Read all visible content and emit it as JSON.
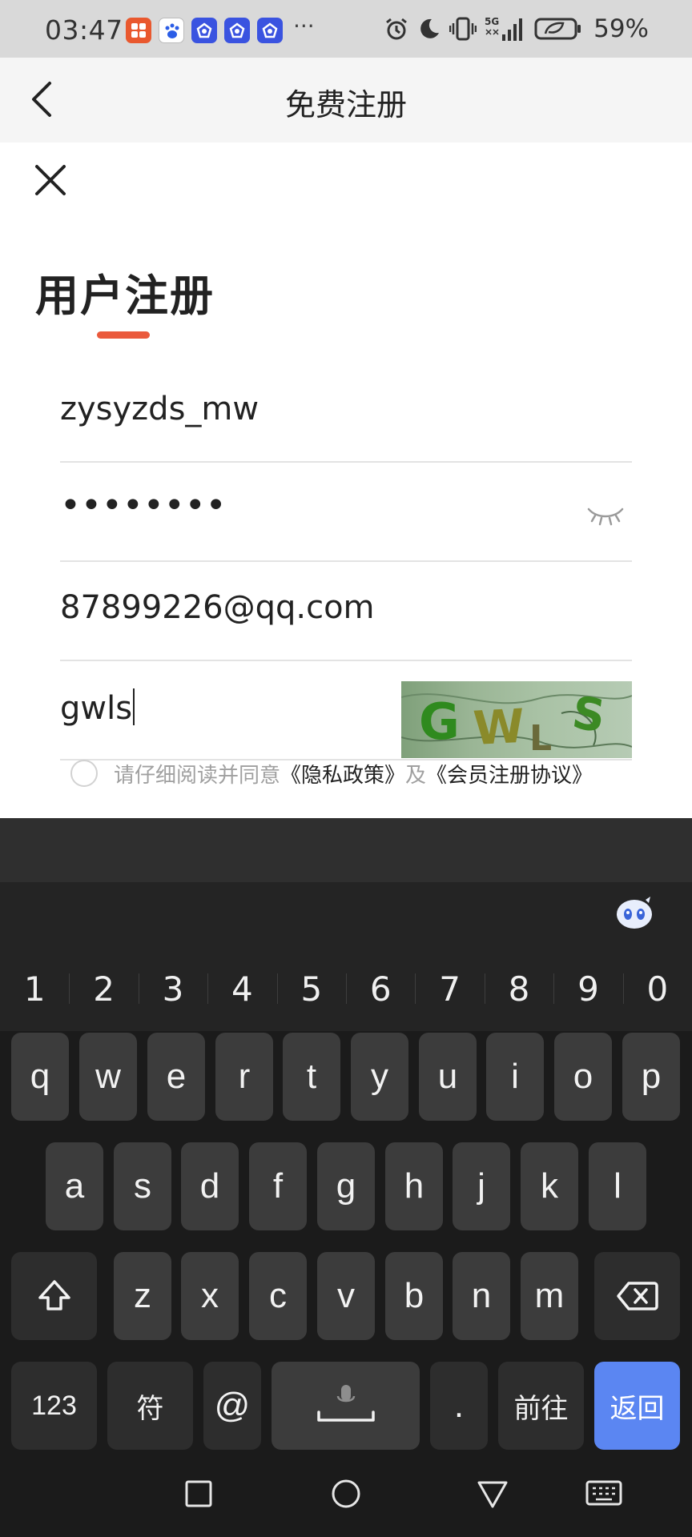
{
  "status_bar": {
    "time": "03:47",
    "overflow": "···",
    "network": "5G",
    "battery": "59%",
    "icons": [
      "app-notification-icon",
      "baidu-icon",
      "app-icon",
      "app-icon",
      "app-icon",
      "alarm-icon",
      "moon-icon",
      "vibrate-icon",
      "signal-icon",
      "battery-icon"
    ]
  },
  "header": {
    "title": "免费注册",
    "back_icon": "chevron-left-icon"
  },
  "form": {
    "close_icon": "close-icon",
    "heading": "用户注册",
    "accent_color": "#ea5a3c",
    "username": "zysyzds_mw",
    "password_masked": "••••••••",
    "password_toggle_icon": "eye-closed-icon",
    "email": "87899226@qq.com",
    "captcha_input": "gwls",
    "captcha_image_text": "GWLS",
    "agreement": {
      "prefix": "请仔细阅读并同意",
      "privacy_link": "《隐私政策》",
      "joiner": "及",
      "terms_link": "《会员注册协议》"
    }
  },
  "keyboard": {
    "logo_icon": "keyboard-mascot-icon",
    "numbers": [
      "1",
      "2",
      "3",
      "4",
      "5",
      "6",
      "7",
      "8",
      "9",
      "0"
    ],
    "row1": [
      "q",
      "w",
      "e",
      "r",
      "t",
      "y",
      "u",
      "i",
      "o",
      "p"
    ],
    "row2": [
      "a",
      "s",
      "d",
      "f",
      "g",
      "h",
      "j",
      "k",
      "l"
    ],
    "row3": [
      "z",
      "x",
      "c",
      "v",
      "b",
      "n",
      "m"
    ],
    "shift_icon": "shift-icon",
    "backspace_icon": "backspace-icon",
    "bottom": {
      "numbers": "123",
      "symbols": "符",
      "at": "@",
      "space_icon": "mic-space-icon",
      "period": ".",
      "go": "前往",
      "return": "返回"
    },
    "return_color": "#5b86f2"
  },
  "nav_bar": {
    "icons": [
      "recent-apps-icon",
      "home-icon",
      "back-icon",
      "keyboard-hide-icon"
    ]
  }
}
